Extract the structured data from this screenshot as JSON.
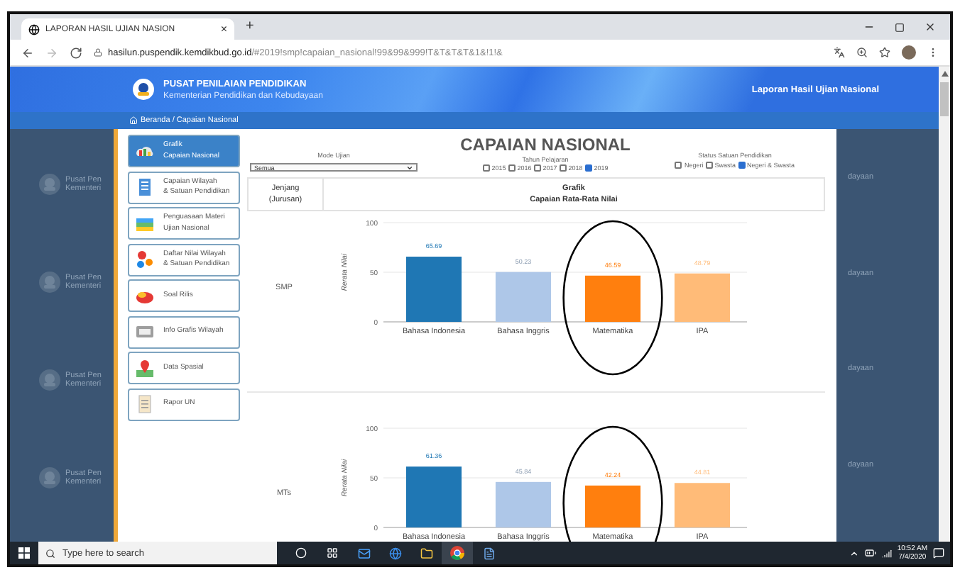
{
  "browser": {
    "tab_title": "LAPORAN HASIL UJIAN NASION",
    "tab_close": "×",
    "new_tab": "+",
    "url_host": "hasilun.puspendik.kemdikbud.go.id",
    "url_path": "/#2019!smp!capaian_nasional!99&99&999!T&T&T&T&1&!1!&"
  },
  "header": {
    "org": "PUSAT PENILAIAN PENDIDIKAN",
    "ministry": "Kementerian Pendidikan dan Kebudayaan",
    "report": "Laporan Hasil Ujian Nasional"
  },
  "breadcrumb": "Beranda / Capaian Nasional",
  "backdrop": {
    "left": [
      {
        "line1": "Pusat Pen",
        "line2": "Kementeri"
      },
      {
        "line1": "Pusat Pen",
        "line2": "Kementeri"
      },
      {
        "line1": "Pusat Pen",
        "line2": "Kementeri"
      },
      {
        "line1": "Pusat Pen",
        "line2": "Kementeri"
      }
    ],
    "right": [
      "dayaan",
      "dayaan",
      "dayaan",
      "dayaan"
    ]
  },
  "menu": [
    {
      "kind": "chart",
      "lines": [
        "Grafik",
        "Capaian Nasional"
      ],
      "selected": true
    },
    {
      "kind": "document",
      "lines": [
        "Capaian Wilayah",
        "& Satuan Pendidikan"
      ],
      "selected": false
    },
    {
      "kind": "books",
      "lines": [
        "Penguasaan Materi",
        "Ujian Nasional"
      ],
      "selected": false
    },
    {
      "kind": "dots",
      "lines": [
        "Daftar Nilai Wilayah",
        "& Satuan Pendidikan"
      ],
      "selected": false
    },
    {
      "kind": "bag",
      "lines": [
        "Soal Rilis"
      ],
      "selected": false
    },
    {
      "kind": "infographic",
      "lines": [
        "Info Grafis Wilayah"
      ],
      "selected": false
    },
    {
      "kind": "map",
      "lines": [
        "Data Spasial"
      ],
      "selected": false
    },
    {
      "kind": "report",
      "lines": [
        "Rapor UN"
      ],
      "selected": false
    }
  ],
  "filters": {
    "title": "CAPAIAN NASIONAL",
    "mode_label": "Mode Ujian",
    "mode_value": "Semua",
    "year_label": "Tahun Pelajaran",
    "years": [
      {
        "label": "2015",
        "checked": false
      },
      {
        "label": "2016",
        "checked": false
      },
      {
        "label": "2017",
        "checked": false
      },
      {
        "label": "2018",
        "checked": false
      },
      {
        "label": "2019",
        "checked": true
      }
    ],
    "status_label": "Status Satuan Pendidikan",
    "statuses": [
      {
        "label": "Negeri",
        "checked": false
      },
      {
        "label": "Swasta",
        "checked": false
      },
      {
        "label": "Negeri & Swasta",
        "checked": true
      }
    ]
  },
  "table": {
    "columns": [
      [
        "Jenjang",
        "(Jurusan)"
      ],
      [
        "Grafik",
        "Capaian Rata-Rata Nilai"
      ]
    ],
    "rows": [
      {
        "jenjang": "SMP",
        "circled": [
          false,
          false,
          true,
          false
        ],
        "chart_data": {
          "type": "bar",
          "ylabel": "Rerata Nilai",
          "categories": [
            "Bahasa Indonesia",
            "Bahasa Inggris",
            "Matematika",
            "IPA"
          ],
          "values": [
            65.69,
            50.23,
            46.59,
            48.79
          ],
          "ylim": [
            0,
            100
          ],
          "yticks": [
            0,
            50,
            100
          ],
          "data_labels": true
        }
      },
      {
        "jenjang": "MTs",
        "circled": [
          false,
          false,
          true,
          false
        ],
        "chart_data": {
          "type": "bar",
          "ylabel": "Rerata Nilai",
          "categories": [
            "Bahasa Indonesia",
            "Bahasa Inggris",
            "Matematika",
            "IPA"
          ],
          "values": [
            61.36,
            45.84,
            42.24,
            44.81
          ],
          "ylim": [
            0,
            100
          ],
          "yticks": [
            0,
            50,
            100
          ],
          "data_labels": true
        }
      }
    ]
  },
  "taskbar": {
    "search_placeholder": "Type here to search",
    "time": "10:52 AM",
    "date": "7/4/2020"
  }
}
